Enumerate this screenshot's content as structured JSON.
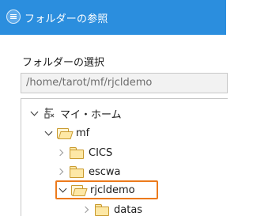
{
  "window": {
    "title": "フォルダーの参照",
    "icon": "eclipse-app-icon",
    "titlebar_color": "#2b8ede"
  },
  "dialog": {
    "section_label": "フォルダーの選択",
    "selected_path": "/home/tarot/mf/rjcldemo"
  },
  "tree": {
    "items": [
      {
        "label": "マイ・ホーム",
        "icon": "home-icon",
        "expanded": true
      },
      {
        "label": "mf",
        "icon": "folder-open-icon",
        "expanded": true
      },
      {
        "label": "CICS",
        "icon": "folder-icon",
        "expanded": false
      },
      {
        "label": "escwa",
        "icon": "folder-icon",
        "expanded": false
      },
      {
        "label": "rjcldemo",
        "icon": "folder-open-icon",
        "expanded": true,
        "highlighted": true
      },
      {
        "label": "datas",
        "icon": "folder-icon",
        "expanded": false
      }
    ]
  },
  "colors": {
    "highlight_border": "#ec7a1c",
    "folder_fill": "#fde8a6",
    "folder_stroke": "#c99a2e"
  }
}
